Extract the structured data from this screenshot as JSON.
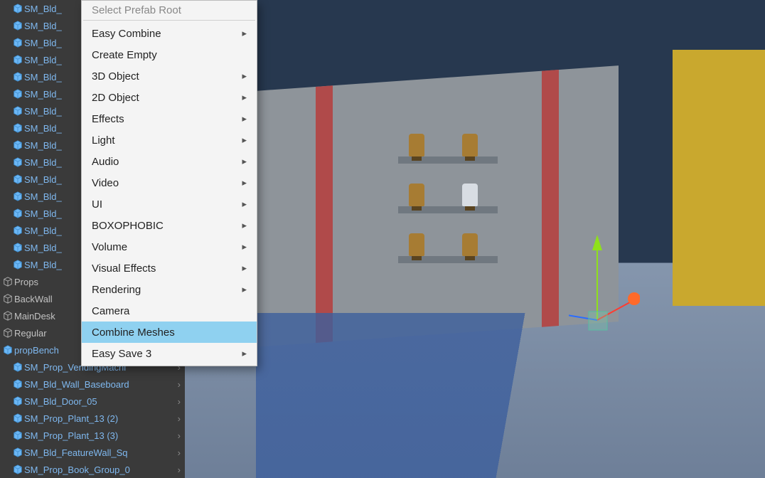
{
  "hierarchy": {
    "items": [
      {
        "label": "SM_Bld_",
        "indent": 1,
        "tone": "blue",
        "icon": "cube"
      },
      {
        "label": "SM_Bld_",
        "indent": 1,
        "tone": "blue",
        "icon": "cube"
      },
      {
        "label": "SM_Bld_",
        "indent": 1,
        "tone": "blue",
        "icon": "cube"
      },
      {
        "label": "SM_Bld_",
        "indent": 1,
        "tone": "blue",
        "icon": "cube"
      },
      {
        "label": "SM_Bld_",
        "indent": 1,
        "tone": "blue",
        "icon": "cube"
      },
      {
        "label": "SM_Bld_",
        "indent": 1,
        "tone": "blue",
        "icon": "cube"
      },
      {
        "label": "SM_Bld_",
        "indent": 1,
        "tone": "blue",
        "icon": "cube"
      },
      {
        "label": "SM_Bld_",
        "indent": 1,
        "tone": "blue",
        "icon": "cube"
      },
      {
        "label": "SM_Bld_",
        "indent": 1,
        "tone": "blue",
        "icon": "cube"
      },
      {
        "label": "SM_Bld_",
        "indent": 1,
        "tone": "blue",
        "icon": "cube"
      },
      {
        "label": "SM_Bld_",
        "indent": 1,
        "tone": "blue",
        "icon": "cube"
      },
      {
        "label": "SM_Bld_",
        "indent": 1,
        "tone": "blue",
        "icon": "cube"
      },
      {
        "label": "SM_Bld_",
        "indent": 1,
        "tone": "blue",
        "icon": "cube"
      },
      {
        "label": "SM_Bld_",
        "indent": 1,
        "tone": "blue",
        "icon": "cube"
      },
      {
        "label": "SM_Bld_",
        "indent": 1,
        "tone": "blue",
        "icon": "cube"
      },
      {
        "label": "SM_Bld_",
        "indent": 1,
        "tone": "blue",
        "icon": "cube"
      },
      {
        "label": "Props",
        "indent": 0,
        "tone": "grey",
        "icon": "cube-outline",
        "arrow": true
      },
      {
        "label": "BackWall",
        "indent": 0,
        "tone": "grey",
        "icon": "cube-outline",
        "arrow": true
      },
      {
        "label": "MainDesk",
        "indent": 0,
        "tone": "grey",
        "icon": "cube-outline",
        "arrow": true
      },
      {
        "label": "Regular",
        "indent": 0,
        "tone": "grey",
        "icon": "cube-outline",
        "arrow": true
      },
      {
        "label": "propBench",
        "indent": 0,
        "tone": "blue",
        "icon": "cube",
        "arrow": true
      },
      {
        "label": "SM_Prop_VendingMachi",
        "indent": 1,
        "tone": "blue",
        "icon": "cube",
        "arrow": true
      },
      {
        "label": "SM_Bld_Wall_Baseboard",
        "indent": 1,
        "tone": "blue",
        "icon": "cube",
        "arrow": true
      },
      {
        "label": "SM_Bld_Door_05",
        "indent": 1,
        "tone": "blue",
        "icon": "cube",
        "arrow": true
      },
      {
        "label": "SM_Prop_Plant_13 (2)",
        "indent": 1,
        "tone": "blue",
        "icon": "cube",
        "arrow": true
      },
      {
        "label": "SM_Prop_Plant_13 (3)",
        "indent": 1,
        "tone": "blue",
        "icon": "cube",
        "arrow": true
      },
      {
        "label": "SM_Bld_FeatureWall_Sq",
        "indent": 1,
        "tone": "blue",
        "icon": "cube",
        "arrow": true
      },
      {
        "label": "SM_Prop_Book_Group_0",
        "indent": 1,
        "tone": "blue",
        "icon": "cube",
        "arrow": true
      }
    ]
  },
  "context_menu": {
    "truncated_top": "Select Prefab Root",
    "items": [
      {
        "label": "Easy Combine",
        "submenu": true
      },
      {
        "label": "Create Empty"
      },
      {
        "label": "3D Object",
        "submenu": true
      },
      {
        "label": "2D Object",
        "submenu": true
      },
      {
        "label": "Effects",
        "submenu": true
      },
      {
        "label": "Light",
        "submenu": true
      },
      {
        "label": "Audio",
        "submenu": true
      },
      {
        "label": "Video",
        "submenu": true
      },
      {
        "label": "UI",
        "submenu": true
      },
      {
        "label": "BOXOPHOBIC",
        "submenu": true
      },
      {
        "label": "Volume",
        "submenu": true
      },
      {
        "label": "Visual Effects",
        "submenu": true
      },
      {
        "label": "Rendering",
        "submenu": true
      },
      {
        "label": "Camera"
      },
      {
        "label": "Combine Meshes",
        "highlight": true
      },
      {
        "label": "Easy Save 3",
        "submenu": true
      }
    ]
  },
  "colors": {
    "menu_highlight": "#8fd1f0",
    "hierarchy_blue": "#7fb8ef",
    "gizmo_x": "#ff3b30",
    "gizmo_y": "#8fe01a",
    "gizmo_z": "#2a6cff"
  },
  "icons": {
    "cube": "cube-icon",
    "cube_outline": "cube-outline-icon",
    "chevron_right": "›",
    "submenu_arrow": "▸"
  }
}
